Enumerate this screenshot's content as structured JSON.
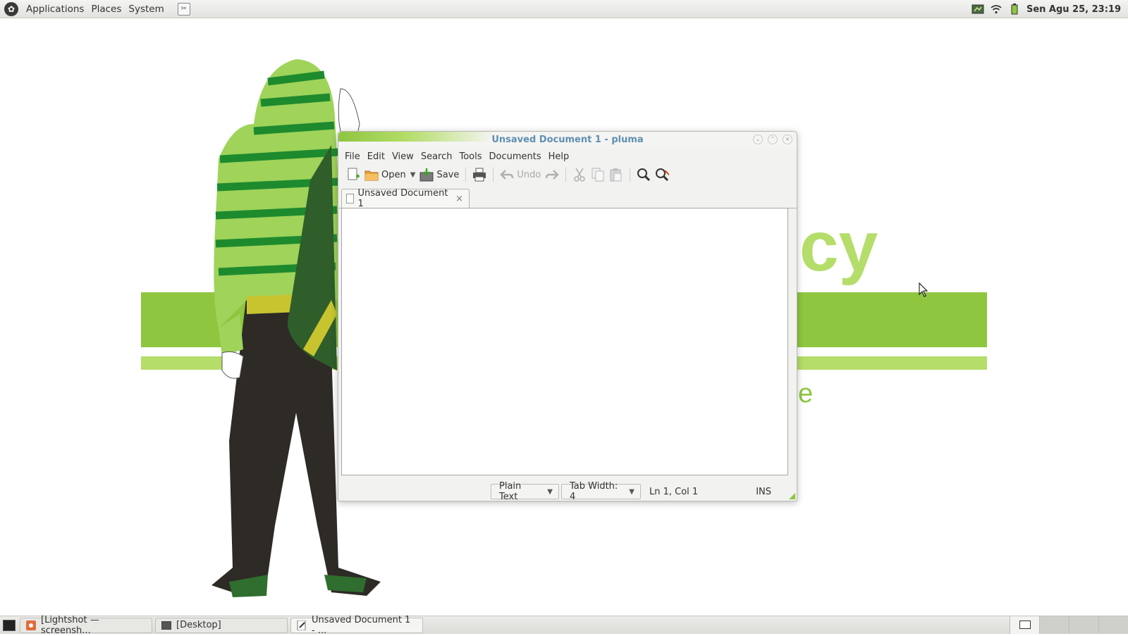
{
  "top_panel": {
    "menus": [
      "Applications",
      "Places",
      "System"
    ],
    "clock": "Sen Agu 25, 23:19"
  },
  "wallpaper": {
    "text_fragment_1": "cy",
    "text_fragment_2": "e"
  },
  "window": {
    "title": "Unsaved Document 1 - pluma",
    "menu": [
      "File",
      "Edit",
      "View",
      "Search",
      "Tools",
      "Documents",
      "Help"
    ],
    "toolbar": {
      "open_label": "Open",
      "save_label": "Save",
      "undo_label": "Undo"
    },
    "tab": {
      "label": "Unsaved Document 1",
      "close": "×"
    },
    "editor": {
      "content": ""
    },
    "statusbar": {
      "language": "Plain Text",
      "tab_width": "Tab Width:  4",
      "position": "Ln 1, Col 1",
      "mode": "INS"
    }
  },
  "taskbar": {
    "tasks": [
      {
        "label": "[Lightshot — screensh...",
        "icon": "lightshot-icon",
        "active": false
      },
      {
        "label": "[Desktop]",
        "icon": "desktop-icon",
        "active": false
      },
      {
        "label": "Unsaved Document 1 - ...",
        "icon": "text-editor-icon",
        "active": true
      }
    ],
    "workspace_count": 4,
    "active_workspace": 1
  },
  "colors": {
    "accent_green": "#8ec63f",
    "light_green": "#b5dd6a",
    "title_blue": "#5e8fb3"
  }
}
